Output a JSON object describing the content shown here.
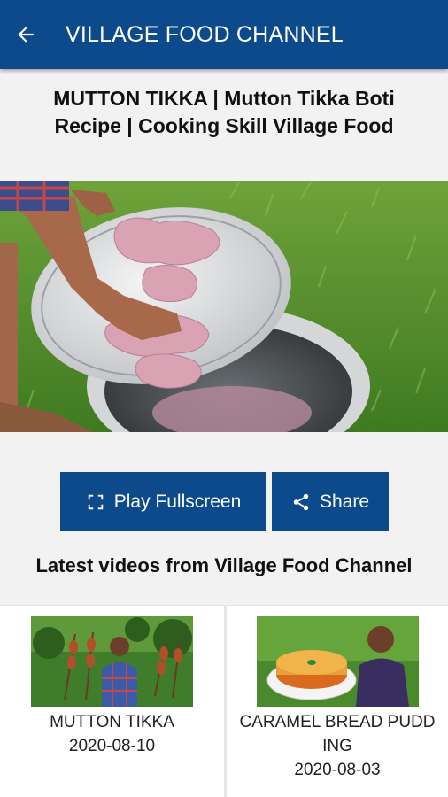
{
  "app_bar": {
    "title": "VILLAGE FOOD CHANNEL",
    "back_icon": "arrow-left-icon",
    "color": "#0c4a8c"
  },
  "video": {
    "title": "MUTTON TIKKA | Mutton Tikka Boti Recipe | Cooking Skill Village Food",
    "thumbnail": "man arranging raw mutton pieces on a steel plate over a pot on grass"
  },
  "actions": {
    "fullscreen_label": "Play Fullscreen",
    "fullscreen_icon": "fullscreen-icon",
    "share_label": "Share",
    "share_icon": "share-icon"
  },
  "latest": {
    "heading": "Latest videos from Village Food Channel",
    "items": [
      {
        "title": "MUTTON TIKKA",
        "date": "2020-08-10"
      },
      {
        "title": "CARAMEL BREAD PUDDING",
        "date": "2020-08-03"
      }
    ]
  }
}
